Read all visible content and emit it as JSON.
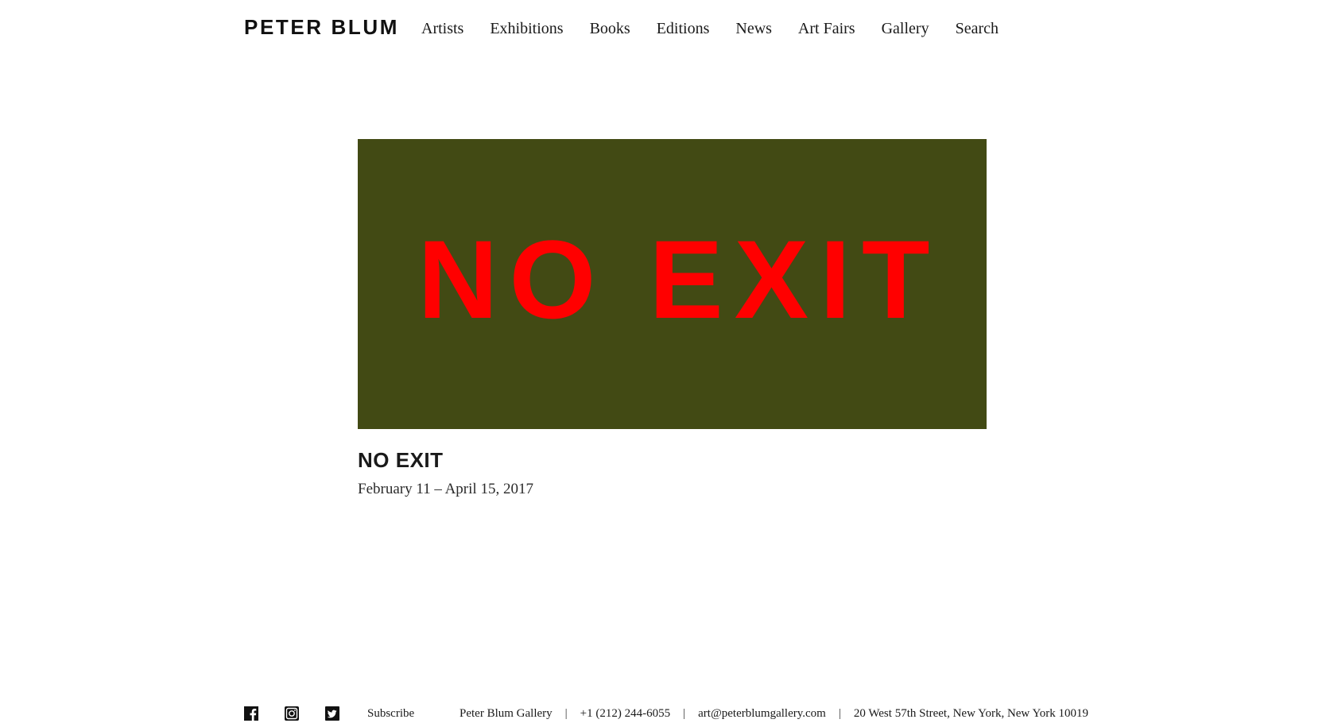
{
  "header": {
    "logo": "PETER BLUM",
    "nav": [
      "Artists",
      "Exhibitions",
      "Books",
      "Editions",
      "News",
      "Art Fairs",
      "Gallery",
      "Search"
    ]
  },
  "exhibition": {
    "banner_text": "NO EXIT",
    "title": "NO EXIT",
    "dates": "February 11 – April 15, 2017"
  },
  "footer": {
    "social_icons": [
      "facebook-icon",
      "instagram-icon",
      "twitter-icon"
    ],
    "subscribe": "Subscribe",
    "gallery_name": "Peter Blum Gallery",
    "phone": "+1 (212) 244-6055",
    "email": "art@peterblumgallery.com",
    "address": "20 West 57th Street, New York, New York 10019",
    "separator": "|"
  },
  "colors": {
    "banner_background": "#424a14",
    "banner_text": "#ff0000"
  }
}
